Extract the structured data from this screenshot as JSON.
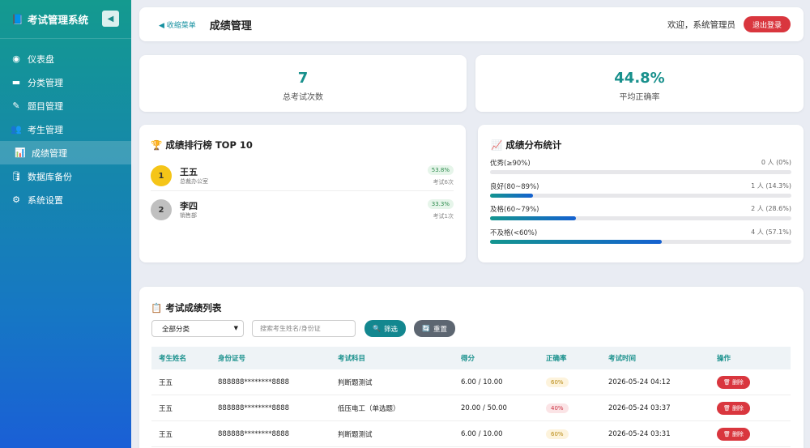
{
  "sidebar": {
    "brand_icon": "📘",
    "brand_title": "考试管理系统",
    "collapse_icon": "◀",
    "items": [
      {
        "label": "仪表盘",
        "icon": "dashboard-icon",
        "glyph": "◉"
      },
      {
        "label": "分类管理",
        "icon": "folder-icon",
        "glyph": "▬"
      },
      {
        "label": "题目管理",
        "icon": "pencil-icon",
        "glyph": "✎"
      },
      {
        "label": "考生管理",
        "icon": "users-icon",
        "glyph": "👥"
      },
      {
        "label": "成绩管理",
        "icon": "bar-chart-icon",
        "glyph": "📊"
      },
      {
        "label": "数据库备份",
        "icon": "database-icon",
        "glyph": "🛢"
      },
      {
        "label": "系统设置",
        "icon": "gear-icon",
        "glyph": "⚙"
      }
    ]
  },
  "header": {
    "collapse_label": "◀ 收缩菜单",
    "title": "成绩管理",
    "welcome": "欢迎，系统管理员",
    "logout_label": "退出登录"
  },
  "stats": {
    "total_exams_value": "7",
    "total_exams_label": "总考试次数",
    "avg_accuracy_value": "44.8%",
    "avg_accuracy_label": "平均正确率"
  },
  "ranking": {
    "icon": "🏆",
    "title": "成绩排行榜 TOP 10",
    "items": [
      {
        "rank": "1",
        "name": "王五",
        "dept": "总裁办公室",
        "rate": "53.8%",
        "count": "考试6次"
      },
      {
        "rank": "2",
        "name": "李四",
        "dept": "销售部",
        "rate": "33.3%",
        "count": "考试1次"
      }
    ]
  },
  "distribution": {
    "icon": "📈",
    "title": "成绩分布统计",
    "rows": [
      {
        "label": "优秀(≥90%)",
        "count": "0 人 (0%)",
        "fraction": 0.0
      },
      {
        "label": "良好(80~89%)",
        "count": "1 人 (14.3%)",
        "fraction": 0.143
      },
      {
        "label": "及格(60~79%)",
        "count": "2 人 (28.6%)",
        "fraction": 0.286
      },
      {
        "label": "不及格(<60%)",
        "count": "4 人 (57.1%)",
        "fraction": 0.571
      }
    ]
  },
  "list": {
    "icon": "📋",
    "title": "考试成绩列表",
    "category_selected": "全部分类",
    "search_placeholder": "搜索考生姓名/身份证",
    "filter_label": "筛选",
    "reset_label": "重置",
    "columns": [
      "考生姓名",
      "身份证号",
      "考试科目",
      "得分",
      "正确率",
      "考试时间",
      "操作"
    ],
    "delete_label": "删除",
    "rows": [
      {
        "name": "王五",
        "id": "888888********8888",
        "subject": "判断题测试",
        "score": "6.00 / 10.00",
        "rate": "60%",
        "time": "2026-05-24 04:12"
      },
      {
        "name": "王五",
        "id": "888888********8888",
        "subject": "低压电工（单选题）",
        "score": "20.00 / 50.00",
        "rate": "40%",
        "time": "2026-05-24 03:37"
      },
      {
        "name": "王五",
        "id": "888888********8888",
        "subject": "判断题测试",
        "score": "6.00 / 10.00",
        "rate": "60%",
        "time": "2026-05-24 03:31"
      }
    ]
  }
}
